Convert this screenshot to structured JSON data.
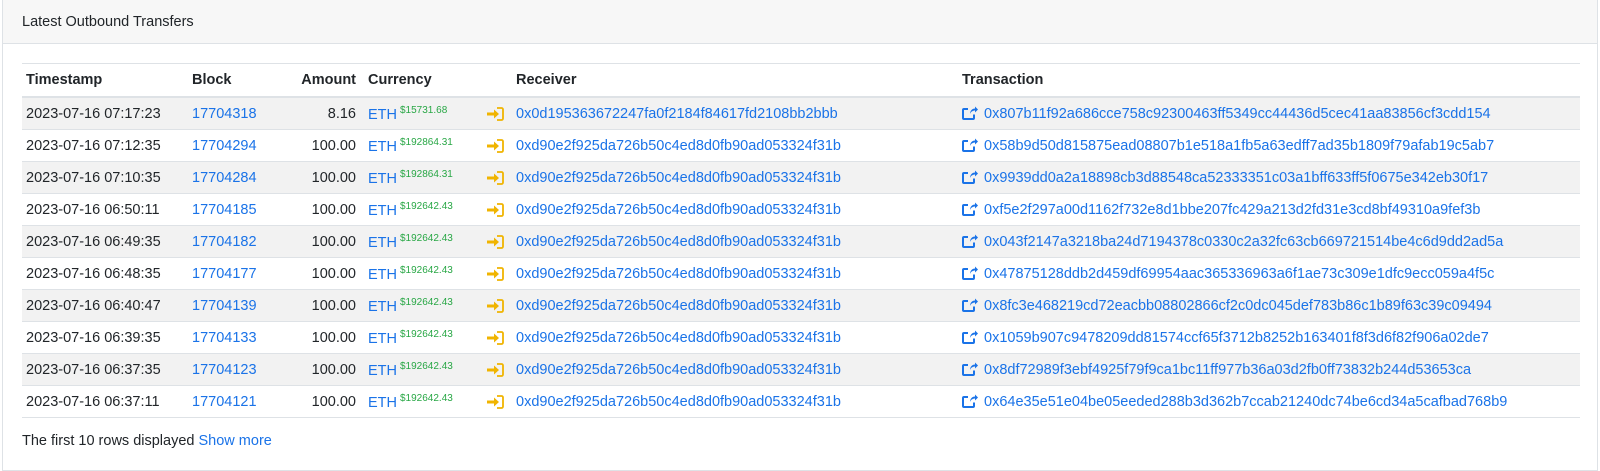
{
  "panel": {
    "title": "Latest Outbound Transfers"
  },
  "table": {
    "headers": {
      "timestamp": "Timestamp",
      "block": "Block",
      "amount": "Amount",
      "currency": "Currency",
      "receiver": "Receiver",
      "transaction": "Transaction"
    },
    "rows": [
      {
        "timestamp": "2023-07-16 07:17:23",
        "block": "17704318",
        "amount": "8.16",
        "currency": "ETH",
        "price": "$15731.68",
        "receiver": "0x0d195363672247fa0f2184f84617fd2108bb2bbb",
        "transaction": "0x807b11f92a686cce758c92300463ff5349cc44436d5cec41aa83856cf3cdd154"
      },
      {
        "timestamp": "2023-07-16 07:12:35",
        "block": "17704294",
        "amount": "100.00",
        "currency": "ETH",
        "price": "$192864.31",
        "receiver": "0xd90e2f925da726b50c4ed8d0fb90ad053324f31b",
        "transaction": "0x58b9d50d815875ead08807b1e518a1fb5a63edff7ad35b1809f79afab19c5ab7"
      },
      {
        "timestamp": "2023-07-16 07:10:35",
        "block": "17704284",
        "amount": "100.00",
        "currency": "ETH",
        "price": "$192864.31",
        "receiver": "0xd90e2f925da726b50c4ed8d0fb90ad053324f31b",
        "transaction": "0x9939dd0a2a18898cb3d88548ca52333351c03a1bff633ff5f0675e342eb30f17"
      },
      {
        "timestamp": "2023-07-16 06:50:11",
        "block": "17704185",
        "amount": "100.00",
        "currency": "ETH",
        "price": "$192642.43",
        "receiver": "0xd90e2f925da726b50c4ed8d0fb90ad053324f31b",
        "transaction": "0xf5e2f297a00d1162f732e8d1bbe207fc429a213d2fd31e3cd8bf49310a9fef3b"
      },
      {
        "timestamp": "2023-07-16 06:49:35",
        "block": "17704182",
        "amount": "100.00",
        "currency": "ETH",
        "price": "$192642.43",
        "receiver": "0xd90e2f925da726b50c4ed8d0fb90ad053324f31b",
        "transaction": "0x043f2147a3218ba24d7194378c0330c2a32fc63cb669721514be4c6d9dd2ad5a"
      },
      {
        "timestamp": "2023-07-16 06:48:35",
        "block": "17704177",
        "amount": "100.00",
        "currency": "ETH",
        "price": "$192642.43",
        "receiver": "0xd90e2f925da726b50c4ed8d0fb90ad053324f31b",
        "transaction": "0x47875128ddb2d459df69954aac365336963a6f1ae73c309e1dfc9ecc059a4f5c"
      },
      {
        "timestamp": "2023-07-16 06:40:47",
        "block": "17704139",
        "amount": "100.00",
        "currency": "ETH",
        "price": "$192642.43",
        "receiver": "0xd90e2f925da726b50c4ed8d0fb90ad053324f31b",
        "transaction": "0x8fc3e468219cd72eacbb08802866cf2c0dc045def783b86c1b89f63c39c09494"
      },
      {
        "timestamp": "2023-07-16 06:39:35",
        "block": "17704133",
        "amount": "100.00",
        "currency": "ETH",
        "price": "$192642.43",
        "receiver": "0xd90e2f925da726b50c4ed8d0fb90ad053324f31b",
        "transaction": "0x1059b907c9478209dd81574ccf65f3712b8252b163401f8f3d6f82f906a02de7"
      },
      {
        "timestamp": "2023-07-16 06:37:35",
        "block": "17704123",
        "amount": "100.00",
        "currency": "ETH",
        "price": "$192642.43",
        "receiver": "0xd90e2f925da726b50c4ed8d0fb90ad053324f31b",
        "transaction": "0x8df72989f3ebf4925f79f9ca1bc11ff977b36a03d2fb0ff73832b244d53653ca"
      },
      {
        "timestamp": "2023-07-16 06:37:11",
        "block": "17704121",
        "amount": "100.00",
        "currency": "ETH",
        "price": "$192642.43",
        "receiver": "0xd90e2f925da726b50c4ed8d0fb90ad053324f31b",
        "transaction": "0x64e35e51e04be05eeded288b3d362b7ccab21240dc74be6cd34a5cafbad768b9"
      }
    ]
  },
  "footer": {
    "text": "The first 10 rows displayed",
    "link": "Show more"
  },
  "colors": {
    "link": "#1a73e8",
    "price": "#28a745",
    "arrow_icon": "#f0b400",
    "stripe": "#f2f2f2"
  },
  "icons": {
    "direction": "sign-out-arrow-icon",
    "transaction": "external-link-icon"
  }
}
